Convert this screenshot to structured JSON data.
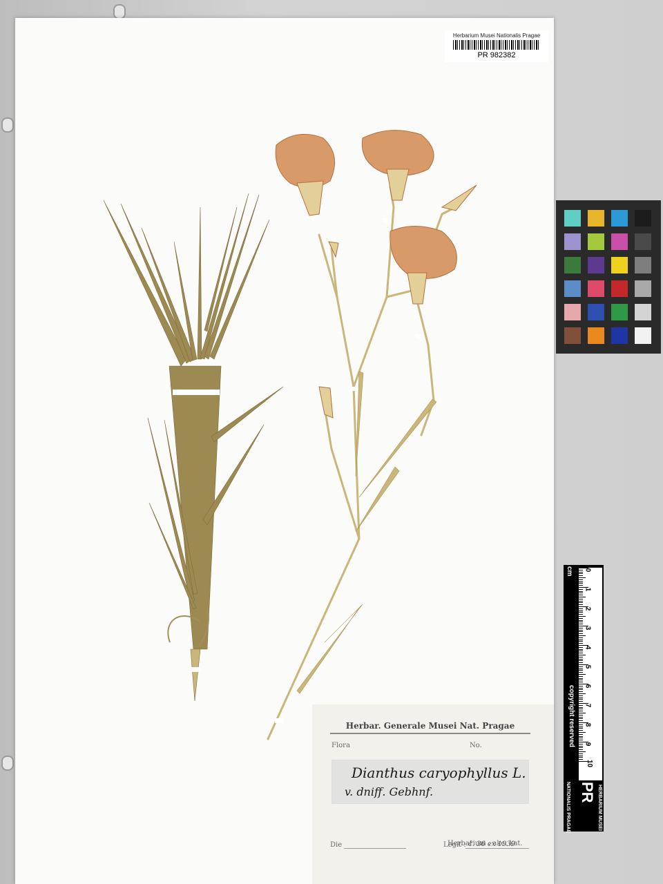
{
  "barcode_label": {
    "institution": "Herbarium Musei Nationalis Pragae",
    "specimen_id": "PR 982382"
  },
  "scale_bar": {
    "unit": "cm",
    "numbers": [
      "0",
      "1",
      "2",
      "3",
      "4",
      "5",
      "6",
      "7",
      "8",
      "9",
      "10"
    ],
    "copyright": "copyright reserved",
    "logo_letters": "PR",
    "logo_top": "HERBARIUM MUSEI",
    "logo_bottom": "NATIONALIS PRAGAE"
  },
  "herbarium_label": {
    "header": "Herbar. Generale Musei Nat. Pragae",
    "flora_label": "Flora",
    "no_label": "No.",
    "handwritten_name": "Dianthus caryophyllus L.",
    "handwritten_note": "v. dniff. Gebhnf.",
    "herbarium_stamp": "Herbarium : akc. kat.",
    "die_label": "Die",
    "legit_label": "Legit :",
    "legit_value": "č. 36 ex 1939"
  },
  "colors": {
    "sheet": "#fbfbfa",
    "leaf": "#9c8a52",
    "stem": "#c9b678",
    "flower": "#d99a6a",
    "calyx": "#e3cf98"
  },
  "color_chart": [
    [
      "#5fcfc6",
      "#e6b52a",
      "#2c9ad6",
      "#1c1c1c"
    ],
    [
      "#9f93cf",
      "#a4c93c",
      "#c94fa9",
      "#4a4a4a"
    ],
    [
      "#3b7a3a",
      "#5b3a8f",
      "#f0d21e",
      "#7d7d7d"
    ],
    [
      "#5b8ec6",
      "#dd4a6a",
      "#c3282a",
      "#a9a9a9"
    ],
    [
      "#e7a8ac",
      "#2f4fb0",
      "#2f9a46",
      "#d4d4d4"
    ],
    [
      "#82503a",
      "#e98a1e",
      "#1f35a4",
      "#f2f2f2"
    ]
  ]
}
